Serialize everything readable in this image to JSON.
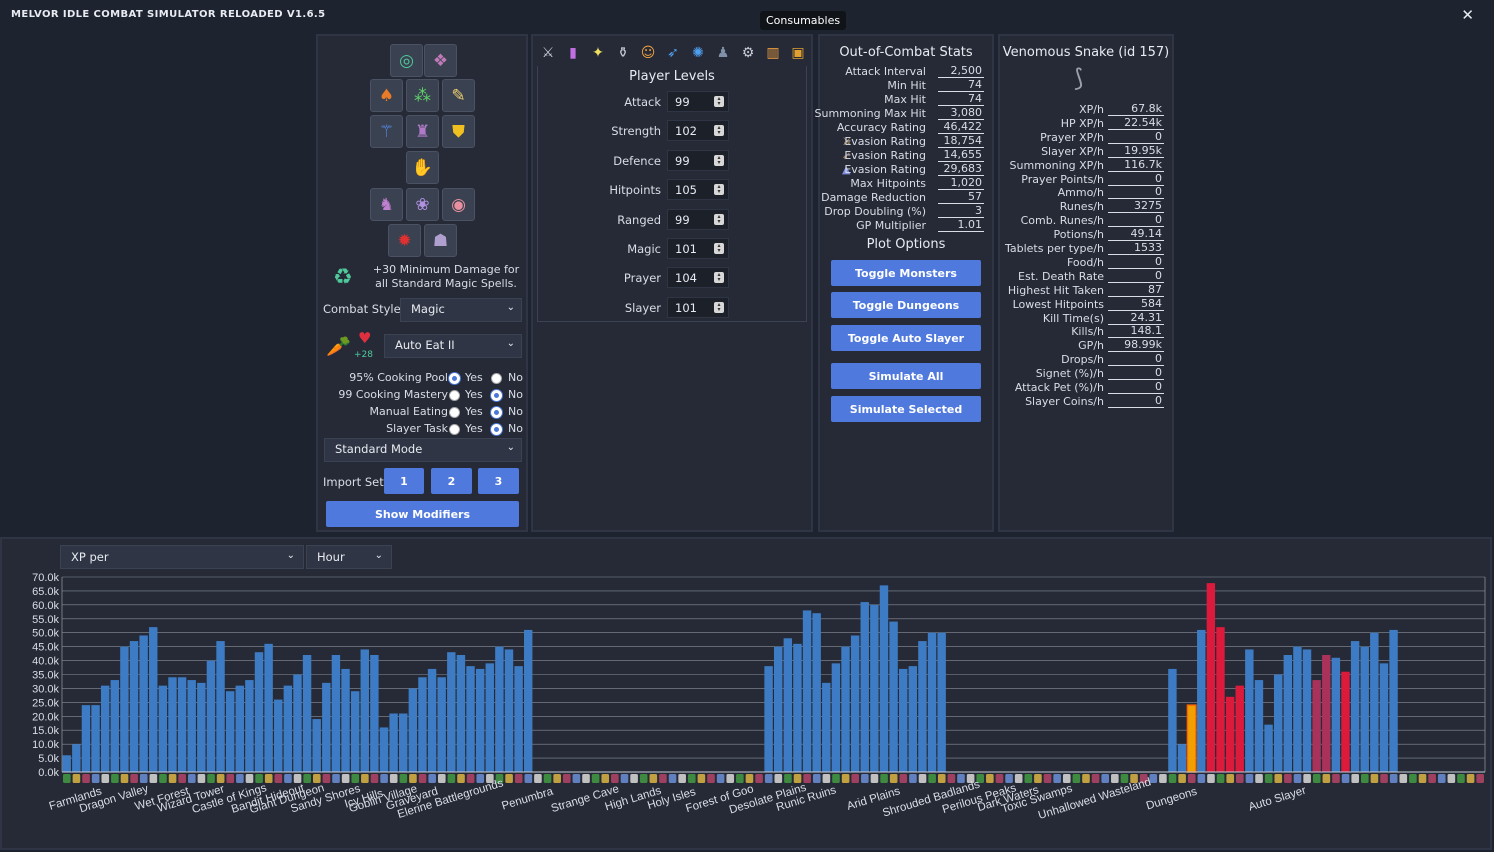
{
  "app": {
    "title": "MELVOR IDLE COMBAT SIMULATOR RELOADED V1.6.5",
    "close": "✕",
    "tooltip": "Consumables"
  },
  "equipment": {
    "slots": [
      {
        "icon": "ring-green-icon",
        "glyph": "◎",
        "color": "#4fc99a"
      },
      {
        "icon": "helmet-icon",
        "glyph": "❖",
        "color": "#c07ab8"
      },
      {
        "icon": "cape-icon",
        "glyph": "♠",
        "color": "#e87b2a"
      },
      {
        "icon": "amulet-icon",
        "glyph": "⁂",
        "color": "#5fd06a"
      },
      {
        "icon": "scroll-icon",
        "glyph": "✎",
        "color": "#f0d070"
      },
      {
        "icon": "staff-icon",
        "glyph": "⚚",
        "color": "#5a8ef0"
      },
      {
        "icon": "body-armour-icon",
        "glyph": "♜",
        "color": "#b07ac8"
      },
      {
        "icon": "shield-icon",
        "glyph": "⛊",
        "color": "#f0c020"
      },
      {
        "icon": "gloves-icon",
        "glyph": "✋",
        "color": "#9a70c8"
      },
      {
        "icon": "legs-icon",
        "glyph": "♞",
        "color": "#c080d0"
      },
      {
        "icon": "boots-icon",
        "glyph": "❀",
        "color": "#b090e0"
      },
      {
        "icon": "ring-icon",
        "glyph": "◉",
        "color": "#e890a0"
      },
      {
        "icon": "summon-familiar-1-icon",
        "glyph": "✹",
        "color": "#e03030"
      },
      {
        "icon": "summon-familiar-2-icon",
        "glyph": "☗",
        "color": "#b0a0d0"
      }
    ],
    "modifier_text": "+30 Minimum Damage for all Standard Magic Spells.",
    "combat_style_label": "Combat Style",
    "combat_style_value": "Magic",
    "food_bonus": "+28",
    "auto_eat_value": "Auto Eat II",
    "radios": [
      {
        "label": "95% Cooking Pool",
        "yes": true
      },
      {
        "label": "99 Cooking Mastery",
        "yes": false
      },
      {
        "label": "Manual Eating",
        "yes": false
      },
      {
        "label": "Slayer Task",
        "yes": false
      }
    ],
    "yes_label": "Yes",
    "no_label": "No",
    "mode_value": "Standard Mode",
    "import_label": "Import Set",
    "import_sets": [
      "1",
      "2",
      "3"
    ],
    "show_modifiers": "Show Modifiers"
  },
  "levels": {
    "tabs": [
      {
        "icon": "combat-swords-icon",
        "glyph": "⚔",
        "color": "#c8cdd8"
      },
      {
        "icon": "spellbook-icon",
        "glyph": "▮",
        "color": "#c070e0"
      },
      {
        "icon": "prayer-icon",
        "glyph": "✦",
        "color": "#f0e060"
      },
      {
        "icon": "potion-icon",
        "glyph": "⚱",
        "color": "#c8cdd8"
      },
      {
        "icon": "pet-cat-icon",
        "glyph": "☺",
        "color": "#f0a040"
      },
      {
        "icon": "agility-icon",
        "glyph": "➶",
        "color": "#50a0f0"
      },
      {
        "icon": "astrology-icon",
        "glyph": "✺",
        "color": "#50a0f0"
      },
      {
        "icon": "hat-icon",
        "glyph": "♟",
        "color": "#8090a8"
      },
      {
        "icon": "settings-gear-icon",
        "glyph": "⚙",
        "color": "#c8cdd8"
      },
      {
        "icon": "statistics-chart-icon",
        "glyph": "▥",
        "color": "#f0a040"
      },
      {
        "icon": "consumables-chest-icon",
        "glyph": "▣",
        "color": "#e0a030"
      }
    ],
    "title": "Player Levels",
    "rows": [
      {
        "skill": "Attack",
        "value": "99"
      },
      {
        "skill": "Strength",
        "value": "102"
      },
      {
        "skill": "Defence",
        "value": "99"
      },
      {
        "skill": "Hitpoints",
        "value": "105"
      },
      {
        "skill": "Ranged",
        "value": "99"
      },
      {
        "skill": "Magic",
        "value": "101"
      },
      {
        "skill": "Prayer",
        "value": "104"
      },
      {
        "skill": "Slayer",
        "value": "101"
      }
    ]
  },
  "ooc": {
    "title": "Out-of-Combat Stats",
    "stats": [
      {
        "label": "Attack Interval",
        "value": "2,500"
      },
      {
        "label": "Min Hit",
        "value": "74"
      },
      {
        "label": "Max Hit",
        "value": "74"
      },
      {
        "label": "Summoning Max Hit",
        "value": "3,080"
      },
      {
        "label": "Accuracy Rating",
        "value": "46,422"
      },
      {
        "label": "Evasion Rating",
        "value": "18,754",
        "icon": "melee-icon"
      },
      {
        "label": "Evasion Rating",
        "value": "14,655",
        "icon": "ranged-icon"
      },
      {
        "label": "Evasion Rating",
        "value": "29,683",
        "icon": "magic-icon"
      },
      {
        "label": "Max Hitpoints",
        "value": "1,020"
      },
      {
        "label": "Damage Reduction",
        "value": "57"
      },
      {
        "label": "Drop Doubling (%)",
        "value": "3"
      },
      {
        "label": "GP Multiplier",
        "value": "1.01"
      }
    ],
    "plot_options_title": "Plot Options",
    "buttons": [
      "Toggle Monsters",
      "Toggle Dungeons",
      "Toggle Auto Slayer",
      "Simulate All",
      "Simulate Selected"
    ]
  },
  "monster": {
    "title": "Venomous Snake (id 157)",
    "stats": [
      {
        "label": "XP/h",
        "value": "67.8k"
      },
      {
        "label": "HP XP/h",
        "value": "22.54k"
      },
      {
        "label": "Prayer XP/h",
        "value": "0"
      },
      {
        "label": "Slayer XP/h",
        "value": "19.95k"
      },
      {
        "label": "Summoning XP/h",
        "value": "116.7k"
      },
      {
        "label": "Prayer Points/h",
        "value": "0"
      },
      {
        "label": "Ammo/h",
        "value": "0"
      },
      {
        "label": "Runes/h",
        "value": "3275"
      },
      {
        "label": "Comb. Runes/h",
        "value": "0"
      },
      {
        "label": "Potions/h",
        "value": "49.14"
      },
      {
        "label": "Tablets per type/h",
        "value": "1533"
      },
      {
        "label": "Food/h",
        "value": "0"
      },
      {
        "label": "Est. Death Rate",
        "value": "0"
      },
      {
        "label": "Highest Hit Taken",
        "value": "87"
      },
      {
        "label": "Lowest Hitpoints",
        "value": "584"
      },
      {
        "label": "Kill Time(s)",
        "value": "24.31"
      },
      {
        "label": "Kills/h",
        "value": "148.1"
      },
      {
        "label": "GP/h",
        "value": "98.99k"
      },
      {
        "label": "Drops/h",
        "value": "0"
      },
      {
        "label": "Signet (%)/h",
        "value": "0"
      },
      {
        "label": "Attack Pet (%)/h",
        "value": "0"
      },
      {
        "label": "Slayer Coins/h",
        "value": "0"
      }
    ]
  },
  "plot": {
    "metric_value": "XP per",
    "period_value": "Hour",
    "colors": {
      "normal": "#3d7cc4",
      "dungeon_red": "#dc1a3c",
      "dark_red": "#a8325a",
      "selected": "#f0a000"
    }
  },
  "chart_data": {
    "type": "bar",
    "ylim": [
      0,
      70000
    ],
    "y_ticks": [
      "0.0k",
      "5.0k",
      "10.0k",
      "15.0k",
      "20.0k",
      "25.0k",
      "30.0k",
      "35.0k",
      "40.0k",
      "45.0k",
      "50.0k",
      "55.0k",
      "60.0k",
      "65.0k",
      "70.0k"
    ],
    "values": [
      6,
      10,
      24,
      24,
      31,
      33,
      45,
      47,
      49,
      52,
      31,
      34,
      34,
      33,
      32,
      40,
      47,
      29,
      31,
      33,
      43,
      46,
      26,
      31,
      35,
      42,
      19,
      32,
      42,
      37,
      29,
      44,
      42,
      16,
      21,
      21,
      30,
      34,
      37,
      34,
      43,
      42,
      38,
      37,
      39,
      45,
      44,
      38,
      51,
      0,
      0,
      0,
      0,
      0,
      0,
      0,
      0,
      0,
      0,
      0,
      0,
      0,
      0,
      0,
      0,
      0,
      0,
      0,
      0,
      0,
      0,
      0,
      0,
      38,
      45,
      48,
      46,
      58,
      57,
      32,
      39,
      45,
      49,
      61,
      60,
      67,
      54,
      37,
      38,
      47,
      50,
      50,
      0,
      0,
      0,
      0,
      0,
      0,
      0,
      0,
      0,
      0,
      0,
      0,
      0,
      0,
      0,
      0,
      0,
      0,
      0,
      0,
      0,
      0,
      0,
      37,
      10,
      24,
      51,
      67.8,
      52,
      27,
      31,
      44,
      33,
      17,
      35,
      42,
      45,
      44,
      33,
      42,
      41,
      36,
      47,
      45,
      50,
      39,
      51,
      0,
      0,
      0,
      0,
      0,
      0,
      0,
      0,
      0
    ],
    "value_units": "k",
    "bar_colors": {
      "113": "dark_red",
      "114": "dark_red",
      "117": "selected",
      "119": "dungeon_red",
      "120": "dungeon_red",
      "121": "dungeon_red",
      "122": "dungeon_red",
      "130": "dark_red",
      "131": "dark_red",
      "133": "dungeon_red"
    },
    "selected_index": 117,
    "area_labels": [
      {
        "label": "Farmlands",
        "at": 1
      },
      {
        "label": "Dragon Valley",
        "at": 5
      },
      {
        "label": "Wet Forest",
        "at": 10
      },
      {
        "label": "Wizard Tower",
        "at": 13
      },
      {
        "label": "Castle of Kings",
        "at": 17
      },
      {
        "label": "Bandit Hideout",
        "at": 21
      },
      {
        "label": "Giant Dungeon",
        "at": 23
      },
      {
        "label": "Sandy Shores",
        "at": 27
      },
      {
        "label": "Icy Hills",
        "at": 31
      },
      {
        "label": "Goblin Village",
        "at": 33
      },
      {
        "label": "Graveyard",
        "at": 36
      },
      {
        "label": "Elerine Battlegrounds",
        "at": 40
      },
      {
        "label": "Penumbra",
        "at": 48
      },
      {
        "label": "Strange Cave",
        "at": 54
      },
      {
        "label": "High Lands",
        "at": 59
      },
      {
        "label": "Holy Isles",
        "at": 63
      },
      {
        "label": "Forest of Goo",
        "at": 68
      },
      {
        "label": "Desolate Plains",
        "at": 73
      },
      {
        "label": "Runic Ruins",
        "at": 77
      },
      {
        "label": "Arid Plains",
        "at": 84
      },
      {
        "label": "Shrouded Badlands",
        "at": 90
      },
      {
        "label": "Perilous Peaks",
        "at": 95
      },
      {
        "label": "Dark Waters",
        "at": 98
      },
      {
        "label": "Toxic Swamps",
        "at": 101
      },
      {
        "label": "Unhallowed Wasteland",
        "at": 107
      },
      {
        "label": "Dungeons",
        "at": 115
      },
      {
        "label": "Auto Slayer",
        "at": 126
      }
    ]
  }
}
